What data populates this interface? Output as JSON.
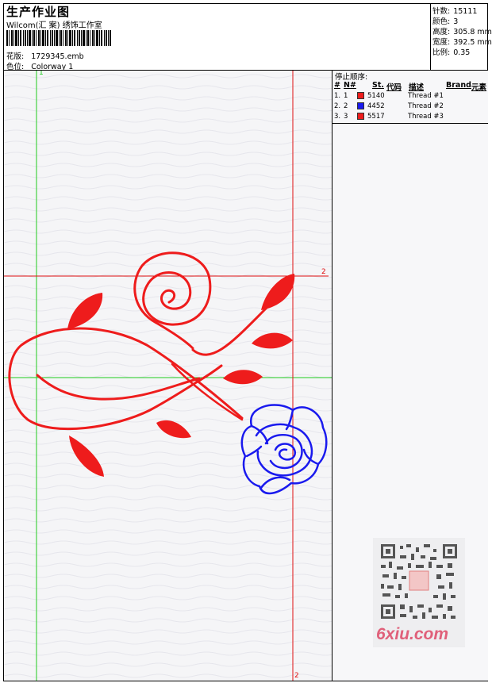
{
  "header": {
    "title": "生产作业图",
    "subtitle": "Wilcom(汇 案) 绣饰工作室",
    "pattern_label": "花版:",
    "pattern_value": "1729345.emb",
    "colorway_label": "色位:",
    "colorway_value": "Colorway 1"
  },
  "stats": [
    {
      "label": "针数:",
      "value": "15111"
    },
    {
      "label": "颜色:",
      "value": "3"
    },
    {
      "label": "高度:",
      "value": "305.8 mm"
    },
    {
      "label": "宽度:",
      "value": "392.5 mm"
    },
    {
      "label": "比例:",
      "value": "0.35"
    }
  ],
  "stop_sequence": {
    "title": "停止顺序:",
    "headers": {
      "num": "#",
      "n": "N#",
      "st": "St.",
      "code": "代码",
      "desc": "描述",
      "brand": "Brand",
      "element": "元素"
    },
    "rows": [
      {
        "num": "1.",
        "n": "1",
        "color": "#ee1c1c",
        "code": "5140",
        "desc": "Thread #1"
      },
      {
        "num": "2.",
        "n": "2",
        "color": "#1a1aee",
        "code": "4452",
        "desc": "Thread #2"
      },
      {
        "num": "3.",
        "n": "3",
        "color": "#ee1c1c",
        "code": "5517",
        "desc": "Thread #3"
      }
    ]
  },
  "canvas": {
    "marker_1": "1",
    "marker_2_right": "2",
    "marker_2_bottom": "2"
  },
  "colors": {
    "red_thread": "#ee1c1c",
    "blue_thread": "#1a1aee",
    "guide_green": "#1ecc1e",
    "guide_red": "#e01010"
  },
  "watermark": {
    "text": "6xiu.com"
  }
}
